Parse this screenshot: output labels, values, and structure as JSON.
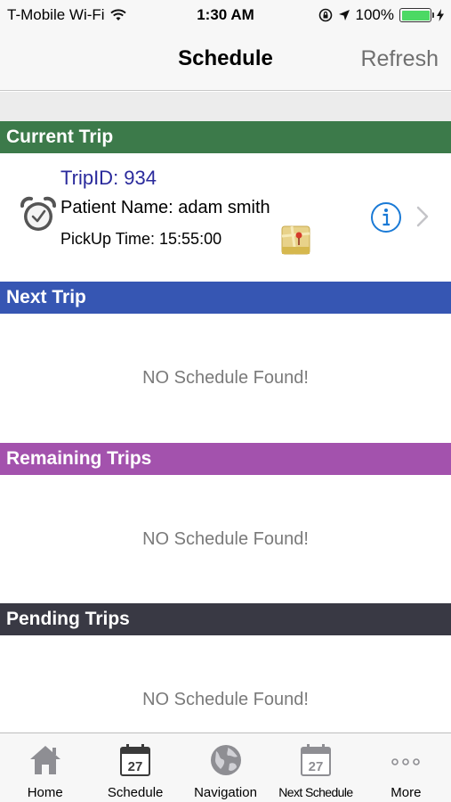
{
  "status_bar": {
    "carrier": "T-Mobile Wi-Fi",
    "time": "1:30 AM",
    "battery": "100%"
  },
  "nav": {
    "title": "Schedule",
    "refresh_label": "Refresh"
  },
  "sections": {
    "current": {
      "title": "Current Trip",
      "color": "#3c7a4a"
    },
    "next": {
      "title": "Next Trip",
      "color": "#3656b3",
      "empty": "NO Schedule Found!"
    },
    "remaining": {
      "title": "Remaining Trips",
      "color": "#a352ad",
      "empty": "NO Schedule Found!"
    },
    "pending": {
      "title": "Pending Trips",
      "color": "#393944",
      "empty": "NO Schedule Found!"
    }
  },
  "current_trip": {
    "trip_id": "TripID: 934",
    "patient": "Patient Name: adam smith",
    "pickup": "PickUp Time: 15:55:00"
  },
  "tab_bar": {
    "items": [
      {
        "label": "Home",
        "icon": "home-icon"
      },
      {
        "label": "Schedule",
        "icon": "calendar-icon",
        "date": "27"
      },
      {
        "label": "Navigation",
        "icon": "globe-icon"
      },
      {
        "label": "Next Schedule",
        "icon": "calendar-icon",
        "date": "27"
      },
      {
        "label": "More",
        "icon": "more-icon"
      }
    ]
  },
  "colors": {
    "info_blue": "#1a7ad6"
  }
}
